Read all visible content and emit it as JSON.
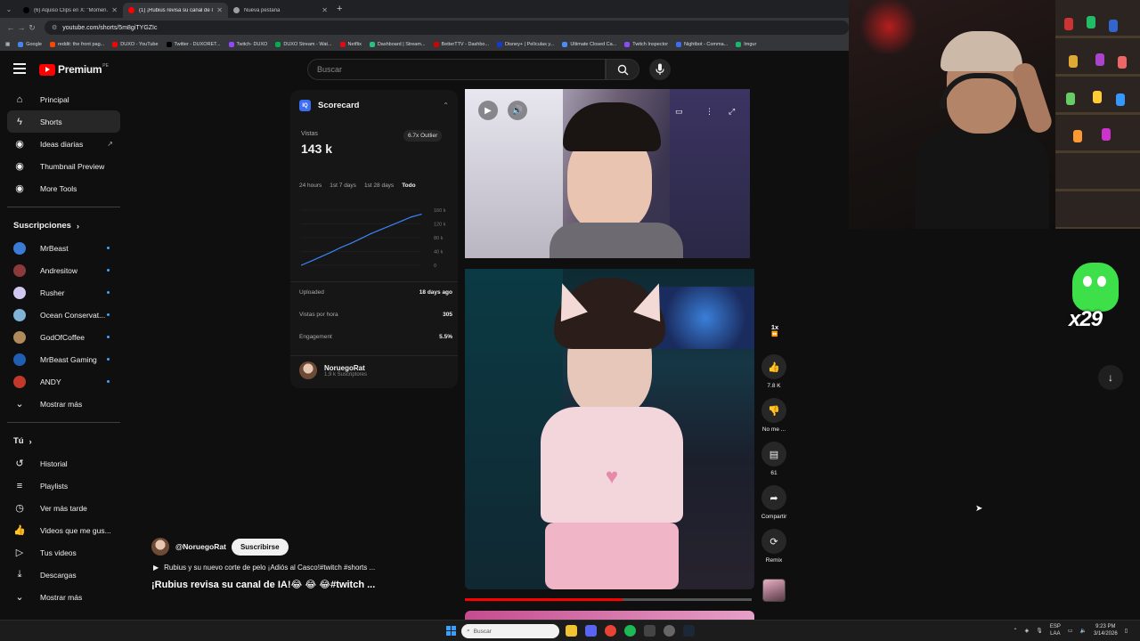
{
  "browser": {
    "tabs": [
      {
        "title": "(6) Aquiso Clips en X: \"Momen...",
        "favicon_color": "#000000"
      },
      {
        "title": "(1) ¡Rubius revisa su canal de I...",
        "favicon_color": "#ff0000",
        "active": true
      },
      {
        "title": "Nueva pestaña",
        "favicon_color": "#9aa0a6"
      }
    ],
    "url": "youtube.com/shorts/5m8giTYGZIc",
    "bookmarks": [
      {
        "label": "Google",
        "color": "#4285f4"
      },
      {
        "label": "reddit: the front pag...",
        "color": "#ff4500"
      },
      {
        "label": "DUXO - YouTube",
        "color": "#ff0000"
      },
      {
        "label": "Twitter - DUXORET...",
        "color": "#000000"
      },
      {
        "label": "Twitch- DUXO",
        "color": "#9146ff"
      },
      {
        "label": "DUXO Stream - Wat...",
        "color": "#00b050"
      },
      {
        "label": "Netflix",
        "color": "#e50914"
      },
      {
        "label": "Dashboard | Stream...",
        "color": "#25c281"
      },
      {
        "label": "BetterTTV - Dashbo...",
        "color": "#d50000"
      },
      {
        "label": "Disney+ | Películas y...",
        "color": "#113ccf"
      },
      {
        "label": "Ultimate Closed Ca...",
        "color": "#4c8bf5"
      },
      {
        "label": "Twitch Inspector",
        "color": "#9146ff"
      },
      {
        "label": "Nightbot - Comma...",
        "color": "#3b6df5"
      },
      {
        "label": "Imgur",
        "color": "#1bb76e"
      }
    ]
  },
  "youtube": {
    "logo_text": "Premium",
    "country_code": "PE",
    "search_placeholder": "Buscar",
    "sidebar": {
      "main": [
        {
          "label": "Principal",
          "icon": "home-icon",
          "glyph": "⌂"
        },
        {
          "label": "Shorts",
          "icon": "shorts-icon",
          "glyph": "ϟ",
          "active": true
        },
        {
          "label": "Ideas diarias",
          "icon": "ideas-icon",
          "glyph": "◉",
          "external": true
        },
        {
          "label": "Thumbnail Preview",
          "icon": "thumbnail-preview-icon",
          "glyph": "◉"
        },
        {
          "label": "More Tools",
          "icon": "tools-icon",
          "glyph": "◉"
        }
      ],
      "subscriptions_title": "Suscripciones",
      "subscriptions": [
        {
          "label": "MrBeast",
          "color": "#3a7bd5"
        },
        {
          "label": "Andresitow",
          "color": "#8b3a3a"
        },
        {
          "label": "Rusher",
          "color": "#d0c8f0"
        },
        {
          "label": "Ocean Conservat...",
          "color": "#7fb3d5"
        },
        {
          "label": "GodOfCoffee",
          "color": "#b08a5a"
        },
        {
          "label": "MrBeast Gaming",
          "color": "#1e5fb4"
        },
        {
          "label": "ANDY",
          "color": "#c0392b"
        }
      ],
      "show_more": "Mostrar más",
      "you_title": "Tú",
      "you_items": [
        {
          "label": "Historial",
          "icon": "history-icon",
          "glyph": "↺"
        },
        {
          "label": "Playlists",
          "icon": "playlists-icon",
          "glyph": "≡"
        },
        {
          "label": "Ver más tarde",
          "icon": "watch-later-icon",
          "glyph": "◷"
        },
        {
          "label": "Videos que me gus...",
          "icon": "liked-icon",
          "glyph": "👍"
        },
        {
          "label": "Tus videos",
          "icon": "your-videos-icon",
          "glyph": "▷"
        },
        {
          "label": "Descargas",
          "icon": "downloads-icon",
          "glyph": "⤓"
        }
      ],
      "show_more_2": "Mostrar más"
    },
    "scorecard": {
      "title": "Scorecard",
      "logo": "IQ",
      "views_label": "Vistas",
      "views": "143 k",
      "outlier": "6.7x Outlier",
      "ranges": [
        "24 hours",
        "1st 7 days",
        "1st 28 days",
        "Todo"
      ],
      "selected_range": "Todo",
      "chart_data": {
        "type": "line",
        "y_ticks": [
          "160 k",
          "120 k",
          "80 k",
          "40 k",
          "0"
        ],
        "ylim": [
          0,
          160
        ],
        "values": [
          0,
          12,
          25,
          38,
          52,
          64,
          78,
          92,
          104,
          116,
          128,
          140,
          148
        ]
      },
      "stats": [
        {
          "label": "Uploaded",
          "value": "18 days ago"
        },
        {
          "label": "Vistas por hora",
          "value": "305"
        },
        {
          "label": "Engagement",
          "value": "5.5%"
        }
      ],
      "channel_name": "NoruegoRat",
      "channel_subs": "1,9 k Suscriptores"
    },
    "video": {
      "channel": "@NoruegoRat",
      "subscribe_label": "Suscribirse",
      "description": "Rubius y su nuevo corte de pelo ¡Adiós al Casco!#twitch #shorts ...",
      "title": "¡Rubius revisa su canal de IA!😂 😂 😂#twitch ...",
      "progress": 0.55,
      "speed": "1x",
      "actions": [
        {
          "name": "like",
          "label": "7.8 K",
          "glyph": "👍"
        },
        {
          "name": "dislike",
          "label": "No me ...",
          "glyph": "👎"
        },
        {
          "name": "comments",
          "label": "61",
          "glyph": "▤"
        },
        {
          "name": "share",
          "label": "Compartir",
          "glyph": "➦"
        },
        {
          "name": "remix",
          "label": "Remix",
          "glyph": "⟳"
        }
      ]
    }
  },
  "overlay": {
    "combo_count": "x29"
  },
  "taskbar": {
    "search_placeholder": "Buscar",
    "lang_top": "ESP",
    "lang_bottom": "LAA",
    "time": "9:23 PM",
    "date": "3/14/2026"
  }
}
